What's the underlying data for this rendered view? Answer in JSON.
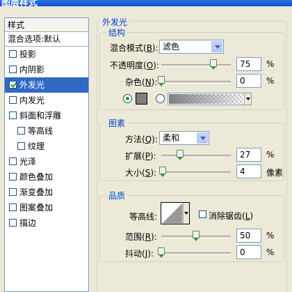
{
  "window": {
    "title": "图层样式"
  },
  "styles_panel": {
    "header": "样式",
    "blend_options": "混合选项:默认",
    "effects": [
      {
        "label": "投影",
        "checked": false
      },
      {
        "label": "内阴影",
        "checked": false
      },
      {
        "label": "外发光",
        "checked": true,
        "selected": true
      },
      {
        "label": "内发光",
        "checked": false
      },
      {
        "label": "斜面和浮雕",
        "checked": false
      },
      {
        "label": "等高线",
        "checked": false,
        "sub": true
      },
      {
        "label": "纹理",
        "checked": false,
        "sub": true
      },
      {
        "label": "光泽",
        "checked": false
      },
      {
        "label": "颜色叠加",
        "checked": false
      },
      {
        "label": "渐变叠加",
        "checked": false
      },
      {
        "label": "图案叠加",
        "checked": false
      },
      {
        "label": "描边",
        "checked": false
      }
    ]
  },
  "outer_glow": {
    "title": "外发光",
    "structure": {
      "title": "结构",
      "blend_mode": {
        "label": "混合模式(B):",
        "value": "滤色"
      },
      "opacity": {
        "label": "不透明度(O):",
        "value": "75",
        "unit": "%",
        "level": 75
      },
      "noise": {
        "label": "杂色(N):",
        "value": "0",
        "unit": "%",
        "level": 0
      },
      "glow_color": "#7f7f7f"
    },
    "elements": {
      "title": "图素",
      "technique": {
        "label": "方法(Q):",
        "value": "柔和"
      },
      "spread": {
        "label": "扩展(P):",
        "value": "27",
        "unit": "%",
        "level": 27
      },
      "size": {
        "label": "大小(S):",
        "value": "4",
        "unit": "像素",
        "level": 2
      }
    },
    "quality": {
      "title": "品质",
      "contour_label": "等高线:",
      "anti_alias_label": "消除锯齿(L)",
      "range": {
        "label": "范围(R):",
        "value": "50",
        "unit": "%",
        "level": 50
      },
      "jitter": {
        "label": "抖动(J):",
        "value": "0",
        "unit": "%",
        "level": 0
      }
    }
  }
}
